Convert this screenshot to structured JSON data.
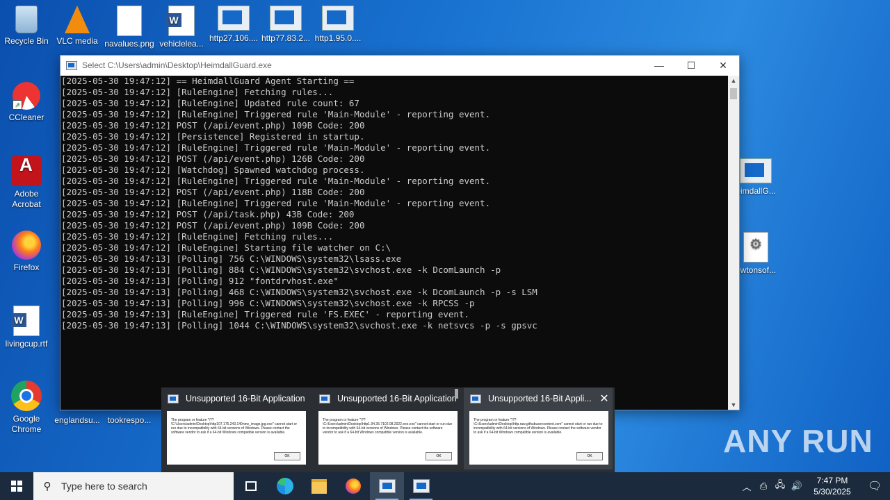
{
  "desktop": {
    "icons": [
      {
        "label": "Recycle Bin"
      },
      {
        "label": "VLC media"
      },
      {
        "label": "navalues.png"
      },
      {
        "label": "vehiclelea..."
      },
      {
        "label": "http27.106...."
      },
      {
        "label": "http77.83.2..."
      },
      {
        "label": "http1.95.0...."
      },
      {
        "label": "CCleaner"
      },
      {
        "label": "Adobe Acrobat"
      },
      {
        "label": "Firefox"
      },
      {
        "label": "livingcup.rtf"
      },
      {
        "label": "Google Chrome"
      },
      {
        "label": "englandsu..."
      },
      {
        "label": "tookrespo..."
      },
      {
        "label": "eimdallG..."
      },
      {
        "label": "ewtonsof..."
      }
    ]
  },
  "console": {
    "title": "Select C:\\Users\\admin\\Desktop\\HeimdallGuard.exe",
    "lines": [
      "[2025-05-30 19:47:12] == HeimdallGuard Agent Starting ==",
      "[2025-05-30 19:47:12] [RuleEngine] Fetching rules...",
      "[2025-05-30 19:47:12] [RuleEngine] Updated rule count: 67",
      "[2025-05-30 19:47:12] [RuleEngine] Triggered rule 'Main-Module' - reporting event.",
      "[2025-05-30 19:47:12] POST (/api/event.php) 109B Code: 200",
      "[2025-05-30 19:47:12] [Persistence] Registered in startup.",
      "[2025-05-30 19:47:12] [RuleEngine] Triggered rule 'Main-Module' - reporting event.",
      "[2025-05-30 19:47:12] POST (/api/event.php) 126B Code: 200",
      "[2025-05-30 19:47:12] [Watchdog] Spawned watchdog process.",
      "[2025-05-30 19:47:12] [RuleEngine] Triggered rule 'Main-Module' - reporting event.",
      "[2025-05-30 19:47:12] POST (/api/event.php) 118B Code: 200",
      "[2025-05-30 19:47:12] [RuleEngine] Triggered rule 'Main-Module' - reporting event.",
      "[2025-05-30 19:47:12] POST (/api/task.php) 43B Code: 200",
      "[2025-05-30 19:47:12] POST (/api/event.php) 109B Code: 200",
      "[2025-05-30 19:47:12] [RuleEngine] Fetching rules...",
      "[2025-05-30 19:47:12] [RuleEngine] Starting file watcher on C:\\",
      "[2025-05-30 19:47:13] [Polling] 756 C:\\WINDOWS\\system32\\lsass.exe",
      "[2025-05-30 19:47:13] [Polling] 884 C:\\WINDOWS\\system32\\svchost.exe -k DcomLaunch -p",
      "[2025-05-30 19:47:13] [Polling] 912 \"fontdrvhost.exe\"",
      "[2025-05-30 19:47:13] [Polling] 468 C:\\WINDOWS\\system32\\svchost.exe -k DcomLaunch -p -s LSM",
      "[2025-05-30 19:47:13] [Polling] 996 C:\\WINDOWS\\system32\\svchost.exe -k RPCSS -p",
      "[2025-05-30 19:47:13] [RuleEngine] Triggered rule 'FS.EXEC' - reporting event.",
      "[2025-05-30 19:47:13] [Polling] 1044 C:\\WINDOWS\\system32\\svchost.exe -k netsvcs -p -s gpsvc"
    ]
  },
  "previews": [
    {
      "title": "Unsupported 16-Bit Application",
      "message": "The program or feature \"\\??\\C:\\Users\\admin\\Desktop\\http107.175.243.140new_image.jpg.exe\" cannot start or run due to incompatibility with 64-bit versions of Windows. Please contact the software vendor to ask if a 64-bit Windows compatible version is available.",
      "ok": "OK"
    },
    {
      "title": "Unsupported 16-Bit Application",
      "message": "The program or feature \"\\??\\C:\\Users\\admin\\Desktop\\http1.94.35.7102.08.2022.exe.exe\" cannot start or run due to incompatibility with 64-bit versions of Windows. Please contact the software vendor to ask if a 64-bit Windows compatible version is available.",
      "ok": "OK"
    },
    {
      "title": "Unsupported 16-Bit Appli...",
      "message": "The program or feature \"\\??\\C:\\Users\\admin\\Desktop\\http.raw.githubusercontent.com\" cannot start or run due to incompatibility with 64-bit versions of Windows. Please contact the software vendor to ask if a 64-bit Windows compatible version is available.",
      "ok": "OK"
    }
  ],
  "watermark": "ANY RUN",
  "taskbar": {
    "search_placeholder": "Type here to search",
    "time": "7:47 PM",
    "date": "5/30/2025"
  }
}
